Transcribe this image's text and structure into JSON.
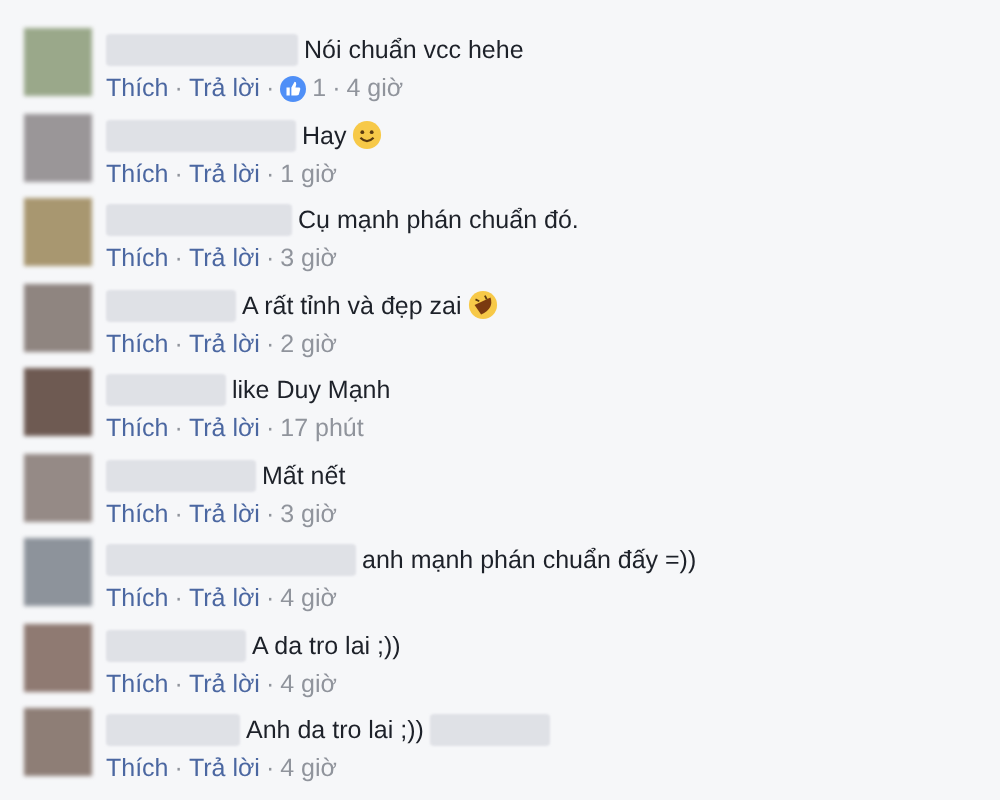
{
  "comments": [
    {
      "kind": "plain",
      "text": "Nói chuẩn vcc hehe",
      "meta": [
        {
          "kind": "link",
          "text": "Thích"
        },
        {
          "kind": "sep",
          "text": "·"
        },
        {
          "kind": "link",
          "text": "Trả lời"
        },
        {
          "kind": "sep",
          "text": "·"
        },
        {
          "kind": "likes",
          "text": "1"
        },
        {
          "kind": "sep",
          "text": "·"
        },
        {
          "kind": "time",
          "text": "4 giờ"
        }
      ]
    },
    {
      "kind": "smile",
      "text": "Hay",
      "meta": [
        {
          "kind": "link",
          "text": "Thích"
        },
        {
          "kind": "sep",
          "text": "·"
        },
        {
          "kind": "link",
          "text": "Trả lời"
        },
        {
          "kind": "sep",
          "text": "·"
        },
        {
          "kind": "time",
          "text": "1 giờ"
        }
      ]
    },
    {
      "kind": "plain",
      "text": "Cụ mạnh phán chuẩn đó.",
      "meta": [
        {
          "kind": "link",
          "text": "Thích"
        },
        {
          "kind": "sep",
          "text": "·"
        },
        {
          "kind": "link",
          "text": "Trả lời"
        },
        {
          "kind": "sep",
          "text": "·"
        },
        {
          "kind": "time",
          "text": "3 giờ"
        }
      ]
    },
    {
      "kind": "laugh",
      "text": "A rất tỉnh và đẹp zai",
      "meta": [
        {
          "kind": "link",
          "text": "Thích"
        },
        {
          "kind": "sep",
          "text": "·"
        },
        {
          "kind": "link",
          "text": "Trả lời"
        },
        {
          "kind": "sep",
          "text": "·"
        },
        {
          "kind": "time",
          "text": "2 giờ"
        }
      ]
    },
    {
      "kind": "plain",
      "text": "like Duy Mạnh",
      "meta": [
        {
          "kind": "link",
          "text": "Thích"
        },
        {
          "kind": "sep",
          "text": "·"
        },
        {
          "kind": "link",
          "text": "Trả lời"
        },
        {
          "kind": "sep",
          "text": "·"
        },
        {
          "kind": "time",
          "text": "17 phút"
        }
      ]
    },
    {
      "kind": "plain",
      "text": "Mất nết",
      "meta": [
        {
          "kind": "link",
          "text": "Thích"
        },
        {
          "kind": "sep",
          "text": "·"
        },
        {
          "kind": "link",
          "text": "Trả lời"
        },
        {
          "kind": "sep",
          "text": "·"
        },
        {
          "kind": "time",
          "text": "3 giờ"
        }
      ]
    },
    {
      "kind": "plain",
      "text": "anh mạnh phán chuẩn đấy =))",
      "meta": [
        {
          "kind": "link",
          "text": "Thích"
        },
        {
          "kind": "sep",
          "text": "·"
        },
        {
          "kind": "link",
          "text": "Trả lời"
        },
        {
          "kind": "sep",
          "text": "·"
        },
        {
          "kind": "time",
          "text": "4 giờ"
        }
      ]
    },
    {
      "kind": "plain",
      "text": "A da tro lai ;))",
      "meta": [
        {
          "kind": "link",
          "text": "Thích"
        },
        {
          "kind": "sep",
          "text": "·"
        },
        {
          "kind": "link",
          "text": "Trả lời"
        },
        {
          "kind": "sep",
          "text": "·"
        },
        {
          "kind": "time",
          "text": "4 giờ"
        }
      ]
    },
    {
      "kind": "plain",
      "text": "Anh da tro lai ;))",
      "trailing_blur": true,
      "meta": [
        {
          "kind": "link",
          "text": "Thích"
        },
        {
          "kind": "sep",
          "text": "·"
        },
        {
          "kind": "link",
          "text": "Trả lời"
        },
        {
          "kind": "sep",
          "text": "·"
        },
        {
          "kind": "time",
          "text": "4 giờ"
        }
      ]
    }
  ]
}
